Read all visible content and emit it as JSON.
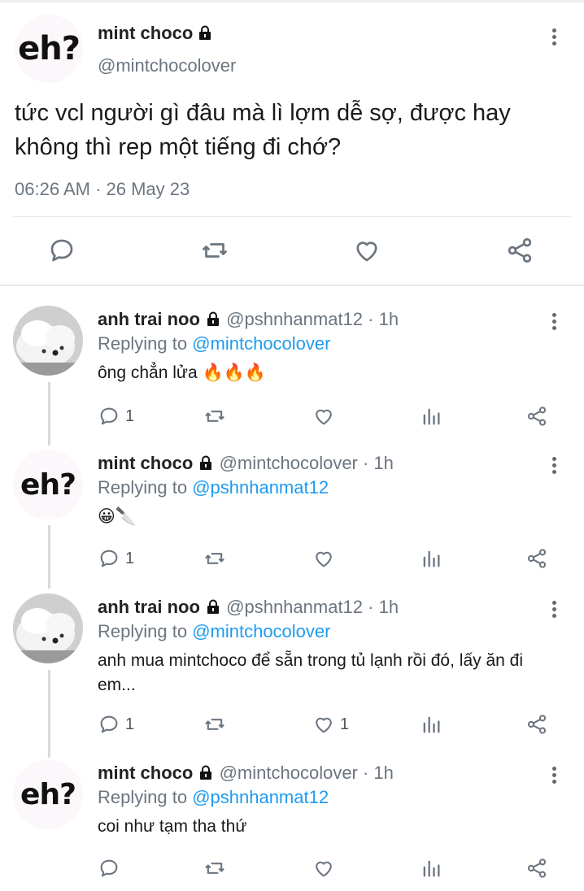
{
  "main_tweet": {
    "name": "mint choco",
    "handle": "@mintchocolover",
    "avatar_text": "eh?",
    "text": "tức vcl người gì đâu mà lì lợm dễ sợ, được hay không thì rep một tiếng đi chớ?",
    "time": "06:26 AM · 26 May 23",
    "actions": [
      "reply-icon",
      "retweet-icon",
      "like-icon",
      "share-icon"
    ]
  },
  "replies": [
    {
      "name": "anh trai noo",
      "handle": "@pshnhanmat12 · 1h",
      "replying_prefix": "Replying to ",
      "replying_to": "@mintchocolover",
      "text": "ông chẳn lửa 🔥🔥🔥",
      "reply_count": "1",
      "like_count": "",
      "avatar": "dog-photo"
    },
    {
      "name": "mint choco",
      "handle": "@mintchocolover · 1h",
      "replying_prefix": "Replying to ",
      "replying_to": "@pshnhanmat12",
      "text": "😀🔪",
      "reply_count": "1",
      "like_count": "",
      "avatar": "eh?"
    },
    {
      "name": "anh trai noo",
      "handle": "@pshnhanmat12 · 1h",
      "replying_prefix": "Replying to ",
      "replying_to": "@mintchocolover",
      "text": "anh mua mintchoco để sẵn trong tủ lạnh rồi đó, lấy ăn đi em...",
      "reply_count": "1",
      "like_count": "1",
      "avatar": "dog-photo"
    },
    {
      "name": "mint choco",
      "handle": "@mintchocolover · 1h",
      "replying_prefix": "Replying to ",
      "replying_to": "@pshnhanmat12",
      "text": "coi như tạm tha thứ",
      "reply_count": "",
      "like_count": "",
      "avatar": "eh?"
    }
  ],
  "colors": {
    "link": "#1d9bf0",
    "muted": "#6b7580",
    "icon": "#6b7580"
  }
}
